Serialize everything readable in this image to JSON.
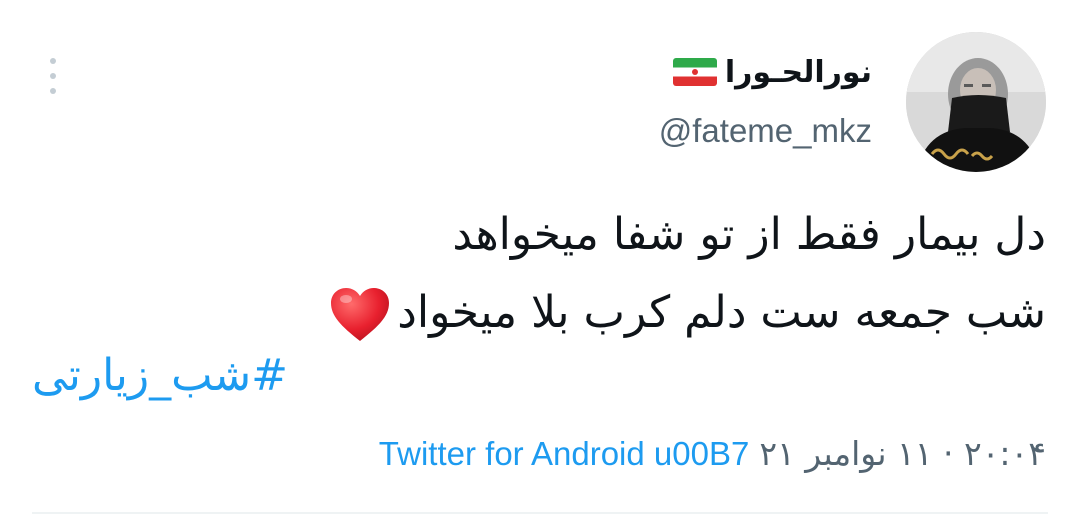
{
  "tweet": {
    "display_name": "نورالحـورا",
    "handle": "@fateme_mkz",
    "text_lines": [
      "دل بیمار فقط از تو شفا میخواهد",
      "شب جمعه ست دلم کرب بلا میخواد"
    ],
    "hashtag": "#شب_زیارتی",
    "timestamp": "۲۰:۰۴ · ۱۱ نوامبر ۲۱",
    "source": "Twitter for Android u00B7"
  },
  "icons": {
    "menu": "more-vertical-icon",
    "flag": "iran-flag-icon",
    "heart": "red-heart-icon"
  },
  "colors": {
    "link": "#1d9bf0",
    "secondary_text": "#536471",
    "primary_text": "#0f1419",
    "heart": "#e8202e"
  }
}
